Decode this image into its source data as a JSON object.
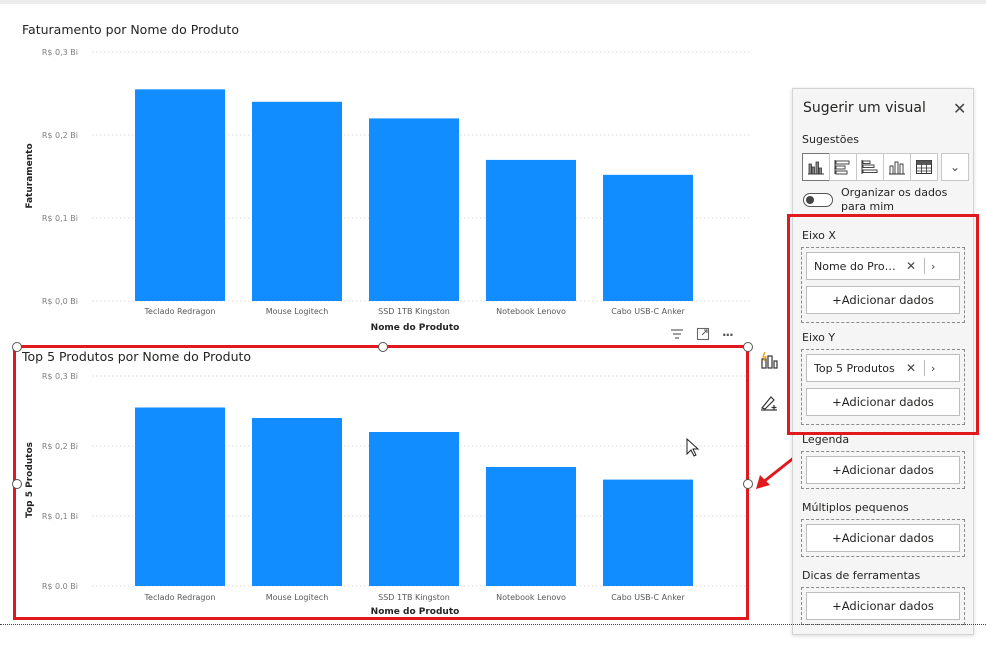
{
  "charts": [
    {
      "title": "Faturamento por Nome do Produto",
      "ylabel": "Faturamento",
      "xlabel": "Nome do Produto",
      "yticks": [
        "R$ 0,3 Bi",
        "R$ 0,2 Bi",
        "R$ 0,1 Bi",
        "R$ 0,0 Bi"
      ]
    },
    {
      "title": "Top 5 Produtos por Nome do Produto",
      "ylabel": "Top 5 Produtos",
      "xlabel": "Nome do Produto",
      "yticks": [
        "R$ 0,3 Bi",
        "R$ 0,2 Bi",
        "R$ 0,1 Bi",
        "R$ 0.0 Bi"
      ]
    }
  ],
  "chart_data": [
    {
      "type": "bar",
      "title": "Faturamento por Nome do Produto",
      "xlabel": "Nome do Produto",
      "ylabel": "Faturamento",
      "categories": [
        "Teclado Redragon",
        "Mouse Logitech",
        "SSD 1TB Kingston",
        "Notebook Lenovo",
        "Cabo USB-C Anker"
      ],
      "values": [
        0.255,
        0.24,
        0.22,
        0.17,
        0.152
      ],
      "unit": "Bi (R$)",
      "ylim": [
        0,
        0.3
      ],
      "grid": true,
      "color": "#118dff"
    },
    {
      "type": "bar",
      "title": "Top 5 Produtos por Nome do Produto",
      "xlabel": "Nome do Produto",
      "ylabel": "Top 5 Produtos",
      "categories": [
        "Teclado Redragon",
        "Mouse Logitech",
        "SSD 1TB Kingston",
        "Notebook Lenovo",
        "Cabo USB-C Anker"
      ],
      "values": [
        0.255,
        0.24,
        0.22,
        0.17,
        0.152
      ],
      "unit": "Bi (R$)",
      "ylim": [
        0,
        0.3
      ],
      "grid": true,
      "color": "#118dff"
    }
  ],
  "visual_header": {
    "icons": [
      "filter-icon",
      "focus-mode-icon",
      "more-options-icon"
    ],
    "more_label": "···"
  },
  "side_tools": {
    "icons": [
      "suggest-visual-icon",
      "format-brush-icon"
    ]
  },
  "panel": {
    "title": "Sugerir um visual",
    "close_label": "✕",
    "suggestions_label": "Sugestões",
    "suggestion_icons": [
      "clustered-column-icon",
      "stacked-bar-icon",
      "clustered-bar-icon",
      "column-icon",
      "table-icon"
    ],
    "expand_label": "⌄",
    "toggle_label": "Organizar os dados para mim",
    "toggle_on": false,
    "x_axis": {
      "label": "Eixo X",
      "field": "Nome do Produto",
      "add_label": "+Adicionar dados"
    },
    "y_axis": {
      "label": "Eixo Y",
      "field": "Top 5 Produtos",
      "add_label": "+Adicionar dados"
    },
    "legend": {
      "label": "Legenda",
      "add_label": "+Adicionar dados"
    },
    "small_multiples": {
      "label": "Múltiplos pequenos",
      "add_label": "+Adicionar dados"
    },
    "tooltips": {
      "label": "Dicas de ferramentas",
      "add_label": "+Adicionar dados"
    },
    "pill_remove": "✕",
    "pill_expand": "›"
  },
  "colors": {
    "bar": "#118dff",
    "highlight": "#e0191f"
  }
}
